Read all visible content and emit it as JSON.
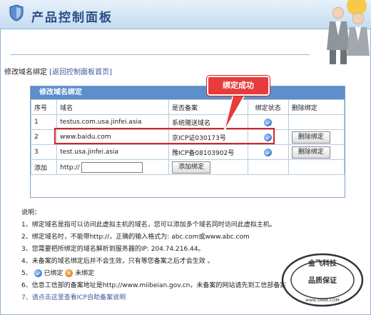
{
  "header": {
    "title": "产品控制面板"
  },
  "breadcrumb": {
    "label": "修改域名绑定",
    "link": "[返回控制面板首页]"
  },
  "panel": {
    "title": "修改域名绑定",
    "columns": [
      "序号",
      "域名",
      "是否备案",
      "绑定状态",
      "删除绑定"
    ],
    "rows": [
      {
        "no": "1",
        "domain": "testus.com.usa.jinfei.asia",
        "record": "系统赠送域名",
        "status": "bound",
        "delete": ""
      },
      {
        "no": "2",
        "domain": "www.baidu.com",
        "record": "京ICP证030173号",
        "status": "bound",
        "delete": "删除绑定"
      },
      {
        "no": "3",
        "domain": "test.usa.jinfei.asia",
        "record": "豫ICP备08103902号",
        "status": "bound",
        "delete": "删除绑定"
      }
    ],
    "add_row": {
      "label": "添加",
      "prefix": "http://",
      "input_value": "",
      "button": "添加绑定"
    }
  },
  "callout": {
    "text": "绑定成功"
  },
  "notes": {
    "heading": "说明：",
    "items": [
      "1、绑定域名是指可以访问此虚拟主机的域名，您可以添加多个域名同时访问此虚拟主机。",
      "2、绑定域名时，不能带http://，正确的输入格式为: abc.com或www.abc.com",
      "3、您需要把所绑定的域名解析到服务器的IP: 204.74.216.44。",
      "4、未备案的域名绑定后并不会生效，只有等您备案之后才会生效 。",
      "6、信息工信部的备案地址是http://www.miibeian.gov.cn，未备案的网站请先到工信部备案"
    ],
    "legend": {
      "prefix": "5、",
      "bound": "已绑定",
      "unbound": "未绑定"
    },
    "link": "7、请点击这里查看ICP自助备案说明"
  },
  "stamp": {
    "text_top": "金飞科技",
    "text_center": "品质保证",
    "text_bottom": "www.3A88.COM"
  },
  "colors": {
    "header_bg": "#c6dcf1",
    "panel_head": "#5c8fcb",
    "callout": "#e83b3b"
  }
}
